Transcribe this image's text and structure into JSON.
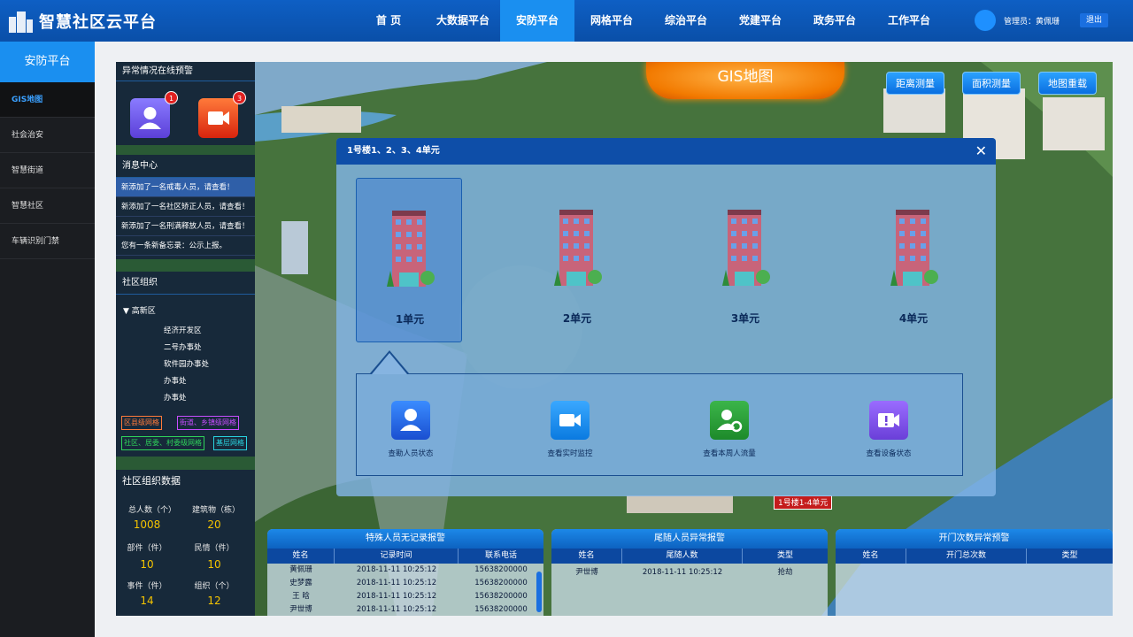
{
  "app": {
    "title": "智慧社区云平台"
  },
  "nav": [
    {
      "label": "首  页"
    },
    {
      "label": "大数据平台"
    },
    {
      "label": "安防平台"
    },
    {
      "label": "网格平台"
    },
    {
      "label": "综治平台"
    },
    {
      "label": "党建平台"
    },
    {
      "label": "政务平台"
    },
    {
      "label": "工作平台"
    }
  ],
  "user": {
    "admin": "管理员：黄佩珊",
    "logout": "退出"
  },
  "sidebar": {
    "head": "安防平台",
    "items": [
      {
        "label": "GIS地图"
      },
      {
        "label": "社会治安"
      },
      {
        "label": "智慧街道"
      },
      {
        "label": "智慧社区"
      },
      {
        "label": "车辆识别门禁"
      }
    ]
  },
  "alerts": {
    "title": "异常情况在线预警",
    "person_count": "1",
    "camera_count": "3"
  },
  "messages": {
    "title": "消息中心",
    "items": [
      "新添加了一名戒毒人员，请查看！",
      "新添加了一名社区矫正人员，请查看！",
      "新添加了一名刑满释放人员，请查看！",
      "您有一条新备忘录：公示上报。"
    ]
  },
  "org": {
    "title": "社区组织",
    "root": "▼ 高新区",
    "children": [
      "经济开发区",
      "二号办事处",
      "软件园办事处",
      "办事处",
      "办事处"
    ],
    "tags": [
      "区县级网格",
      "街道、乡镇级网格",
      "社区、居委、村委级网格",
      "基层网格"
    ]
  },
  "stats": {
    "title": "社区组织数据",
    "items": [
      {
        "label": "总人数（个）",
        "value": "1008"
      },
      {
        "label": "建筑物（栋）",
        "value": "20"
      },
      {
        "label": "部件（件）",
        "value": "10"
      },
      {
        "label": "民情（件）",
        "value": "10"
      },
      {
        "label": "事件（件）",
        "value": "14"
      },
      {
        "label": "组织（个）",
        "value": "12"
      }
    ]
  },
  "map": {
    "title": "GIS地图",
    "tools": [
      "距离测量",
      "面积测量",
      "地图重载"
    ],
    "building_label": "1号楼1-4单元"
  },
  "popup": {
    "title": "1号楼1、2、3、4单元",
    "units": [
      "1单元",
      "2单元",
      "3单元",
      "4单元"
    ],
    "actions": [
      "查勘人员状态",
      "查看实时监控",
      "查看本周人流量",
      "查看设备状态"
    ]
  },
  "tables": {
    "special": {
      "title": "特殊人员无记录报警",
      "headers": [
        "姓名",
        "记录时间",
        "联系电话"
      ],
      "rows": [
        [
          "黄佩珊",
          "2018-11-11 10:25:12",
          "15638200000"
        ],
        [
          "史梦露",
          "2018-11-11 10:25:12",
          "15638200000"
        ],
        [
          "王  晗",
          "2018-11-11 10:25:12",
          "15638200000"
        ],
        [
          "尹世博",
          "2018-11-11 10:25:12",
          "15638200000"
        ]
      ]
    },
    "follow": {
      "title": "尾随人员异常报警",
      "headers": [
        "姓名",
        "尾随人数",
        "类型"
      ],
      "rows": [
        [
          "尹世博",
          "2018-11-11 10:25:12",
          "抢劫"
        ]
      ]
    },
    "door": {
      "title": "开门次数异常预警",
      "headers": [
        "姓名",
        "开门总次数",
        "类型"
      ],
      "rows": []
    }
  },
  "colors": {
    "primary": "#0e5fc4",
    "accent": "#1a8ff0",
    "stat_value": "#f5c400",
    "alert_orange": "#f27a00"
  }
}
